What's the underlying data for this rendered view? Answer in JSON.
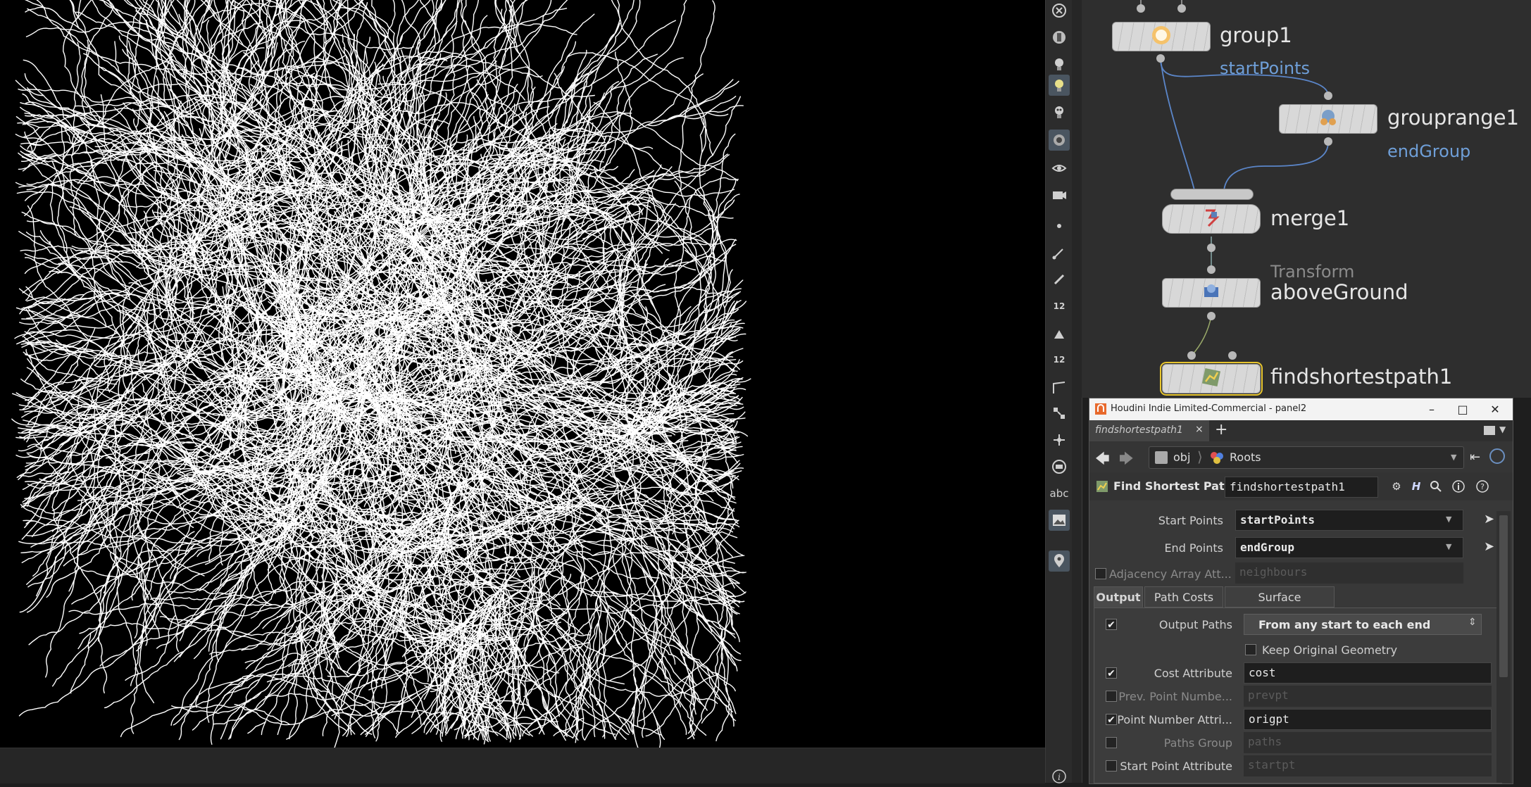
{
  "network": {
    "nodes": [
      {
        "label": "group1"
      },
      {
        "label": "grouprange1"
      },
      {
        "label": "merge1"
      },
      {
        "label": "aboveGround",
        "type": "Transform"
      },
      {
        "label": "findshortestpath1"
      }
    ],
    "wire_labels": [
      "startPoints",
      "endGroup"
    ]
  },
  "toolbar": {
    "number_label_1": "12",
    "number_label_2": "12",
    "abc_label": "abc",
    "info_label": "i"
  },
  "panel": {
    "window_title": "Houdini Indie Limited-Commercial - panel2",
    "tab_label": "findshortestpath1",
    "tab_close": "×",
    "tab_add": "+",
    "path": {
      "obj": "obj",
      "roots": "Roots"
    },
    "node_type": "Find Shortest Path",
    "node_name": "findshortestpath1",
    "params": {
      "start_points": {
        "label": "Start Points",
        "value": "startPoints"
      },
      "end_points": {
        "label": "End Points",
        "value": "endGroup"
      },
      "adjacency": {
        "label": "Adjacency Array Att...",
        "value": "neighbours"
      }
    },
    "subtabs": [
      "Output",
      "Path Costs",
      "Surface Constraints"
    ],
    "output": {
      "output_paths": {
        "label": "Output Paths",
        "value": "From any start to each end"
      },
      "keep_original": {
        "label": "Keep Original Geometry"
      },
      "cost_attribute": {
        "label": "Cost Attribute",
        "value": "cost"
      },
      "prev_point": {
        "label": "Prev. Point Numbe...",
        "value": "prevpt"
      },
      "point_number": {
        "label": "Point Number Attri...",
        "value": "origpt"
      },
      "paths_group": {
        "label": "Paths Group",
        "value": "paths"
      },
      "start_point_attr": {
        "label": "Start Point Attribute",
        "value": "startpt"
      }
    }
  },
  "colors": {
    "wire": "#5b86c9",
    "selected_outline": "#e8c62f",
    "viewport_bg": "#000000",
    "curves": "#ffffff"
  }
}
